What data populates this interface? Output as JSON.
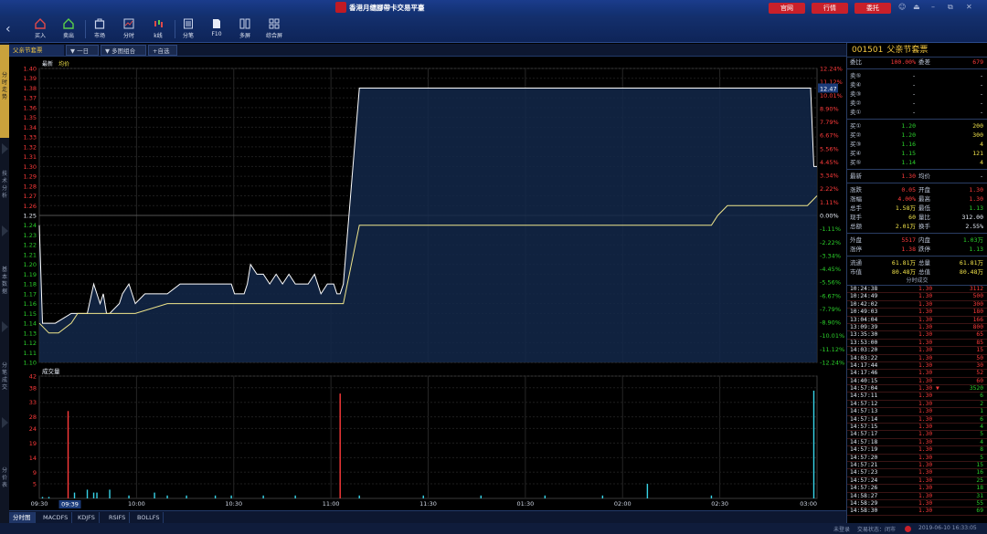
{
  "app": {
    "title": "香港月缱腳帶卡交易平臺",
    "buttons": [
      "官网",
      "行情",
      "委托"
    ],
    "window_controls": [
      "☺",
      "⏏",
      "–",
      "⧉",
      "✕"
    ]
  },
  "toolbar": {
    "items": [
      {
        "label": "买入",
        "icon": "buy-icon"
      },
      {
        "label": "卖出",
        "icon": "sell-icon"
      },
      {
        "label": "市场",
        "icon": "market-icon"
      },
      {
        "label": "分时",
        "icon": "timeshare-icon"
      },
      {
        "label": "k线",
        "icon": "kline-icon"
      },
      {
        "label": "分笔",
        "icon": "ticks-icon"
      },
      {
        "label": "F10",
        "icon": "f10-icon"
      },
      {
        "label": "多屏",
        "icon": "multiscreen-icon"
      },
      {
        "label": "综合屏",
        "icon": "composite-icon"
      }
    ]
  },
  "left_tabs": [
    "分时走势",
    "技术分析",
    "基本数据",
    "分笔成交",
    "分价表"
  ],
  "chart_header": {
    "name": "父亲节套票",
    "period": "一日",
    "mode": "多图组合",
    "add_fav": "+自选",
    "legend_latest": "最新",
    "legend_avg": "均价",
    "vol_label": "成交量",
    "price_tag": "12.47"
  },
  "chart_data": {
    "type": "line",
    "title": "父亲节套票",
    "price_ticks": [
      "1.40",
      "1.39",
      "1.38",
      "1.37",
      "1.36",
      "1.35",
      "1.34",
      "1.33",
      "1.32",
      "1.31",
      "1.30",
      "1.29",
      "1.28",
      "1.27",
      "1.26",
      "1.25",
      "1.24",
      "1.23",
      "1.22",
      "1.21",
      "1.20",
      "1.19",
      "1.18",
      "1.17",
      "1.16",
      "1.15",
      "1.14",
      "1.13",
      "1.12",
      "1.11",
      "1.10"
    ],
    "pct_ticks": [
      "12.24%",
      "11.12%",
      "10.01%",
      "8.90%",
      "7.79%",
      "6.67%",
      "5.56%",
      "4.45%",
      "3.34%",
      "2.22%",
      "1.11%",
      "0.00%",
      "-1.11%",
      "-2.22%",
      "-3.34%",
      "-4.45%",
      "-5.56%",
      "-6.67%",
      "-7.79%",
      "-8.90%",
      "-10.01%",
      "-11.12%",
      "-12.24%"
    ],
    "vol_ticks": [
      "42",
      "38",
      "33",
      "28",
      "24",
      "19",
      "14",
      "9",
      "5"
    ],
    "x_ticks": [
      "09:30",
      "10:00",
      "10:30",
      "11:00",
      "11:30",
      "01:30",
      "02:00",
      "02:30",
      "03:00"
    ],
    "cursor_time": "09:39",
    "prev_close": 1.25,
    "ylim": [
      1.1,
      1.4
    ],
    "vol_max": 42,
    "series": [
      {
        "name": "最新",
        "color": "#ffffff",
        "t": [
          0,
          1,
          5,
          10,
          15,
          17,
          19,
          20,
          21,
          22,
          25,
          26,
          28,
          30,
          33,
          36,
          40,
          44,
          48,
          52,
          56,
          60,
          61,
          62,
          63,
          64,
          65,
          66,
          68,
          70,
          72,
          74,
          76,
          78,
          80,
          82,
          84,
          86,
          88,
          90,
          91,
          92,
          93,
          94,
          95,
          100,
          110,
          120,
          200,
          240,
          241,
          242,
          243
        ],
        "v": [
          1.24,
          1.14,
          1.14,
          1.15,
          1.15,
          1.18,
          1.16,
          1.17,
          1.15,
          1.15,
          1.16,
          1.17,
          1.18,
          1.16,
          1.17,
          1.17,
          1.17,
          1.18,
          1.18,
          1.18,
          1.18,
          1.18,
          1.17,
          1.17,
          1.17,
          1.17,
          1.18,
          1.2,
          1.19,
          1.19,
          1.18,
          1.19,
          1.18,
          1.19,
          1.18,
          1.18,
          1.18,
          1.19,
          1.17,
          1.18,
          1.18,
          1.18,
          1.17,
          1.17,
          1.18,
          1.38,
          1.38,
          1.38,
          1.38,
          1.38,
          1.38,
          1.3,
          1.3
        ]
      },
      {
        "name": "均价",
        "color": "#f0e68c",
        "t": [
          0,
          3,
          6,
          10,
          12,
          20,
          30,
          40,
          50,
          60,
          80,
          94,
          95,
          100,
          150,
          200,
          210,
          212,
          215,
          230,
          240,
          243
        ],
        "v": [
          1.14,
          1.13,
          1.13,
          1.14,
          1.15,
          1.15,
          1.15,
          1.16,
          1.16,
          1.16,
          1.16,
          1.16,
          1.16,
          1.24,
          1.24,
          1.24,
          1.24,
          1.25,
          1.26,
          1.26,
          1.26,
          1.27
        ]
      }
    ],
    "volume": [
      {
        "t": 1,
        "v": 0.5
      },
      {
        "t": 3,
        "v": 0.5
      },
      {
        "t": 9,
        "v": 30
      },
      {
        "t": 11,
        "v": 2
      },
      {
        "t": 15,
        "v": 3
      },
      {
        "t": 17,
        "v": 2
      },
      {
        "t": 18,
        "v": 2
      },
      {
        "t": 22,
        "v": 3
      },
      {
        "t": 28,
        "v": 1
      },
      {
        "t": 36,
        "v": 2
      },
      {
        "t": 40,
        "v": 1
      },
      {
        "t": 46,
        "v": 1
      },
      {
        "t": 55,
        "v": 1
      },
      {
        "t": 60,
        "v": 1
      },
      {
        "t": 70,
        "v": 1
      },
      {
        "t": 80,
        "v": 1
      },
      {
        "t": 94,
        "v": 36
      },
      {
        "t": 100,
        "v": 1
      },
      {
        "t": 120,
        "v": 1
      },
      {
        "t": 138,
        "v": 1
      },
      {
        "t": 158,
        "v": 1
      },
      {
        "t": 176,
        "v": 1
      },
      {
        "t": 190,
        "v": 5
      },
      {
        "t": 210,
        "v": 1
      },
      {
        "t": 242,
        "v": 37
      }
    ]
  },
  "quote": {
    "code": "001501",
    "name": "父亲节套票",
    "ratio": [
      {
        "l": "委比",
        "v": "100.00%",
        "l2": "委差",
        "v2": "679"
      }
    ],
    "asks": [
      {
        "l": "卖⑤",
        "p": "-",
        "q": "-"
      },
      {
        "l": "卖④",
        "p": "-",
        "q": "-"
      },
      {
        "l": "卖③",
        "p": "-",
        "q": "-"
      },
      {
        "l": "卖②",
        "p": "-",
        "q": "-"
      },
      {
        "l": "卖①",
        "p": "-",
        "q": "-"
      }
    ],
    "bids": [
      {
        "l": "买①",
        "p": "1.20",
        "q": "200"
      },
      {
        "l": "买②",
        "p": "1.20",
        "q": "300"
      },
      {
        "l": "买③",
        "p": "1.16",
        "q": "4"
      },
      {
        "l": "买④",
        "p": "1.15",
        "q": "121"
      },
      {
        "l": "买⑤",
        "p": "1.14",
        "q": "4"
      }
    ],
    "stats": [
      {
        "l": "最新",
        "v": "1.30",
        "vc": "red",
        "l2": "均价",
        "v2": "-",
        "v2c": "wht"
      },
      {
        "l": "涨跌",
        "v": "0.05",
        "vc": "red",
        "l2": "开盘",
        "v2": "1.30",
        "v2c": "red"
      },
      {
        "l": "涨幅",
        "v": "4.00%",
        "vc": "red",
        "l2": "最高",
        "v2": "1.30",
        "v2c": "red"
      },
      {
        "l": "总手",
        "v": "1.58万",
        "vc": "yel",
        "l2": "最低",
        "v2": "1.13",
        "v2c": "green"
      },
      {
        "l": "现手",
        "v": "60",
        "vc": "yel",
        "l2": "量比",
        "v2": "312.00",
        "v2c": "wht"
      },
      {
        "l": "总额",
        "v": "2.01万",
        "vc": "yel",
        "l2": "换手",
        "v2": "2.55%",
        "v2c": "wht"
      },
      {
        "l": "外盘",
        "v": "5517",
        "vc": "red",
        "l2": "内盘",
        "v2": "1.03万",
        "v2c": "green"
      },
      {
        "l": "涨停",
        "v": "1.38",
        "vc": "red",
        "l2": "跌停",
        "v2": "1.13",
        "v2c": "green"
      },
      {
        "l": "流通",
        "v": "61.81万",
        "vc": "yel",
        "l2": "总量",
        "v2": "61.81万",
        "v2c": "yel"
      },
      {
        "l": "市值",
        "v": "80.48万",
        "vc": "yel",
        "l2": "总值",
        "v2": "80.48万",
        "v2c": "yel"
      }
    ]
  },
  "trades_header": "分时成交",
  "trades": [
    {
      "t": "10:24:38",
      "p": "1.30",
      "v": "3112",
      "c": "red"
    },
    {
      "t": "10:24:49",
      "p": "1.30",
      "v": "500",
      "c": "red"
    },
    {
      "t": "10:42:02",
      "p": "1.30",
      "v": "300",
      "c": "red"
    },
    {
      "t": "10:49:03",
      "p": "1.30",
      "v": "180",
      "c": "red"
    },
    {
      "t": "13:04:04",
      "p": "1.30",
      "v": "166",
      "c": "red"
    },
    {
      "t": "13:09:39",
      "p": "1.30",
      "v": "800",
      "c": "red"
    },
    {
      "t": "13:35:30",
      "p": "1.30",
      "v": "65",
      "c": "red"
    },
    {
      "t": "13:53:00",
      "p": "1.30",
      "v": "85",
      "c": "red"
    },
    {
      "t": "14:03:20",
      "p": "1.30",
      "v": "15",
      "c": "red"
    },
    {
      "t": "14:03:22",
      "p": "1.30",
      "v": "50",
      "c": "red"
    },
    {
      "t": "14:17:44",
      "p": "1.30",
      "v": "30",
      "c": "red"
    },
    {
      "t": "14:17:46",
      "p": "1.30",
      "v": "52",
      "c": "red"
    },
    {
      "t": "14:40:15",
      "p": "1.30",
      "v": "60",
      "c": "red"
    },
    {
      "t": "14:57:04",
      "p": "1.30 ▼",
      "v": "3520",
      "c": "green"
    },
    {
      "t": "14:57:11",
      "p": "1.30",
      "v": "6",
      "c": "green"
    },
    {
      "t": "14:57:12",
      "p": "1.30",
      "v": "2",
      "c": "green"
    },
    {
      "t": "14:57:13",
      "p": "1.30",
      "v": "1",
      "c": "green"
    },
    {
      "t": "14:57:14",
      "p": "1.30",
      "v": "6",
      "c": "green"
    },
    {
      "t": "14:57:15",
      "p": "1.30",
      "v": "4",
      "c": "green"
    },
    {
      "t": "14:57:17",
      "p": "1.30",
      "v": "5",
      "c": "green"
    },
    {
      "t": "14:57:18",
      "p": "1.30",
      "v": "4",
      "c": "green"
    },
    {
      "t": "14:57:19",
      "p": "1.30",
      "v": "8",
      "c": "green"
    },
    {
      "t": "14:57:20",
      "p": "1.30",
      "v": "5",
      "c": "green"
    },
    {
      "t": "14:57:21",
      "p": "1.30",
      "v": "15",
      "c": "green"
    },
    {
      "t": "14:57:23",
      "p": "1.30",
      "v": "16",
      "c": "green"
    },
    {
      "t": "14:57:24",
      "p": "1.30",
      "v": "25",
      "c": "green"
    },
    {
      "t": "14:57:26",
      "p": "1.30",
      "v": "18",
      "c": "green"
    },
    {
      "t": "14:58:27",
      "p": "1.30",
      "v": "31",
      "c": "green"
    },
    {
      "t": "14:58:29",
      "p": "1.30",
      "v": "55",
      "c": "green"
    },
    {
      "t": "14:58:30",
      "p": "1.30",
      "v": "69",
      "c": "green"
    }
  ],
  "bottom_tabs": [
    "分时图",
    "MACDFS",
    "KDJFS",
    "RSIFS",
    "BOLLFS"
  ],
  "status": {
    "left": "未登录",
    "state": "交易状态：闭市",
    "time": "2019-06-10 16:33:05"
  }
}
